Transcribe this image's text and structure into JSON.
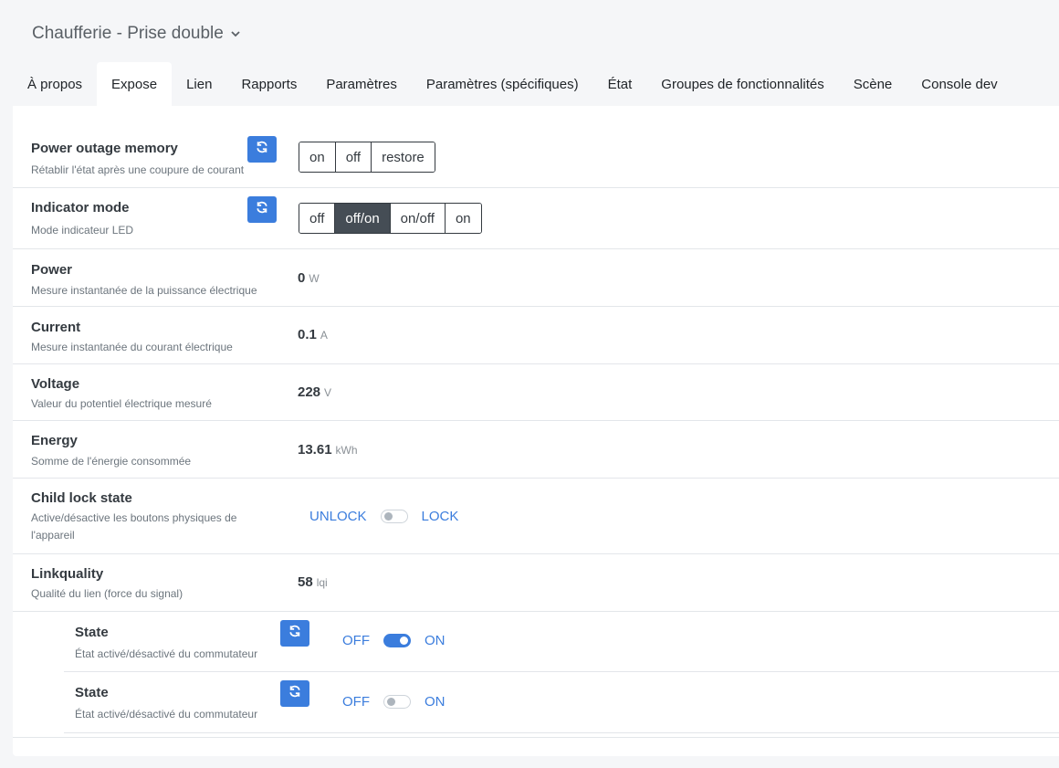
{
  "device": {
    "title": "Chaufferie - Prise double"
  },
  "tabs": [
    {
      "label": "À propos"
    },
    {
      "label": "Expose"
    },
    {
      "label": "Lien"
    },
    {
      "label": "Rapports"
    },
    {
      "label": "Paramètres"
    },
    {
      "label": "Paramètres (spécifiques)"
    },
    {
      "label": "État"
    },
    {
      "label": "Groupes de fonctionnalités"
    },
    {
      "label": "Scène"
    },
    {
      "label": "Console dev"
    }
  ],
  "active_tab": "Expose",
  "features": {
    "power_outage": {
      "name": "Power outage memory",
      "desc": "Rétablir l'état après une coupure de courant",
      "options": [
        "on",
        "off",
        "restore"
      ]
    },
    "indicator": {
      "name": "Indicator mode",
      "desc": "Mode indicateur LED",
      "options": [
        "off",
        "off/on",
        "on/off",
        "on"
      ],
      "selected": "off/on"
    },
    "power": {
      "name": "Power",
      "desc": "Mesure instantanée de la puissance électrique",
      "value": "0",
      "unit": "W"
    },
    "current": {
      "name": "Current",
      "desc": "Mesure instantanée du courant électrique",
      "value": "0.1",
      "unit": "A"
    },
    "voltage": {
      "name": "Voltage",
      "desc": "Valeur du potentiel électrique mesuré",
      "value": "228",
      "unit": "V"
    },
    "energy": {
      "name": "Energy",
      "desc": "Somme de l'énergie consommée",
      "value": "13.61",
      "unit": "kWh"
    },
    "child_lock": {
      "name": "Child lock state",
      "desc_line1": "Active/désactive les boutons physiques de",
      "desc_line2": "l'appareil",
      "off_label": "UNLOCK",
      "on_label": "LOCK",
      "state": "off"
    },
    "linkquality": {
      "name": "Linkquality",
      "desc": "Qualité du lien (force du signal)",
      "value": "58",
      "unit": "lqi"
    },
    "state1": {
      "name": "State",
      "desc": "État activé/désactivé du commutateur",
      "off_label": "OFF",
      "on_label": "ON",
      "state": "on"
    },
    "state2": {
      "name": "State",
      "desc": "État activé/désactivé du commutateur",
      "off_label": "OFF",
      "on_label": "ON",
      "state": "off"
    }
  },
  "icons": {
    "refresh": "refresh-icon",
    "chevron": "chevron-down-icon"
  },
  "colors": {
    "accent": "#3b7ddd",
    "selected": "#454d55"
  }
}
